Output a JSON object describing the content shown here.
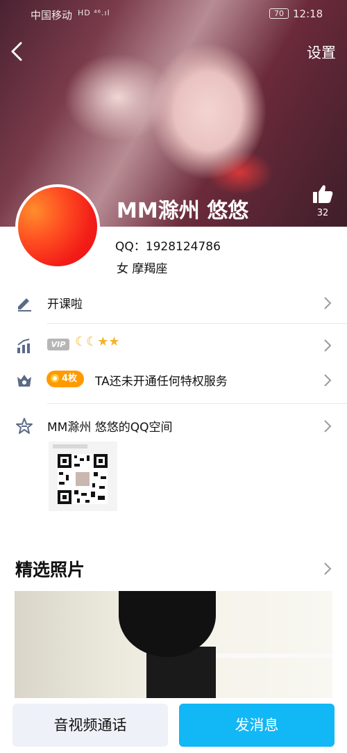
{
  "status_bar": {
    "carrier": "中国移动",
    "signal": "HD ⁴⁶.ıl",
    "battery": "70",
    "time": "12:18"
  },
  "header": {
    "settings_label": "设置",
    "like_count": "32"
  },
  "profile": {
    "nickname": "MM滁州 悠悠",
    "qq_line": "QQ：1928124786",
    "gender_zodiac": "女 摩羯座"
  },
  "rows": {
    "signature": "开课啦",
    "vip_badge": "VIP",
    "vip_levels": "☾☾★★",
    "coin_label": "4枚",
    "privilege_text": "TA还未开通任何特权服务",
    "qzone": "MM滁州 悠悠的QQ空间"
  },
  "photos": {
    "section_title": "精选照片"
  },
  "bottom_bar": {
    "call_label": "音视频通话",
    "message_label": "发消息"
  },
  "colors": {
    "accent": "#12b7f5",
    "coin": "#ff9a00",
    "avatar": "#f31d18"
  }
}
